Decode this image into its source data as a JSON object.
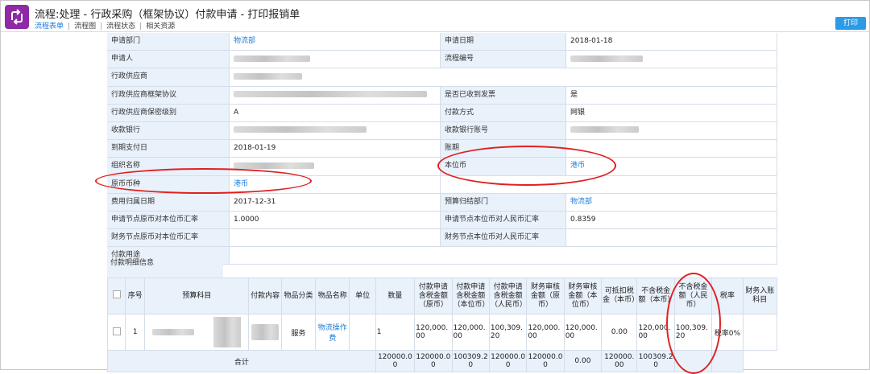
{
  "header": {
    "title": "流程:处理 - 行政采购（框架协议）付款申请 - 打印报销单",
    "tabs": [
      "流程表单",
      "流程图",
      "流程状态",
      "相关资源"
    ],
    "print_label": "打印",
    "logo_icon": "workflow-icon"
  },
  "form": {
    "rows": [
      {
        "l1": "申请部门",
        "v1": "物流部",
        "l2": "申请日期",
        "v2": "2018-01-18"
      },
      {
        "l1": "申请人",
        "v1": "",
        "l2": "流程编号",
        "v2": ""
      },
      {
        "l1": "行政供应商",
        "v1": "",
        "l2": "",
        "v2": ""
      },
      {
        "l1": "行政供应商框架协议",
        "v1": "",
        "l2": "是否已收到发票",
        "v2": "是"
      },
      {
        "l1": "行政供应商保密级别",
        "v1": "A",
        "l2": "付款方式",
        "v2": "网银"
      },
      {
        "l1": "收款银行",
        "v1": "",
        "l2": "收款银行账号",
        "v2": ""
      },
      {
        "l1": "到期支付日",
        "v1": "2018-01-19",
        "l2": "账期",
        "v2": ""
      },
      {
        "l1": "组织名称",
        "v1": "",
        "l2": "本位币",
        "v2": "港币"
      },
      {
        "l1": "原币币种",
        "v1": "港币",
        "l2": "",
        "v2": ""
      },
      {
        "l1": "费用归属日期",
        "v1": "2017-12-31",
        "l2": "预算归结部门",
        "v2": "物流部"
      },
      {
        "l1": "申请节点原币对本位币汇率",
        "v1": "1.0000",
        "l2": "申请节点本位币对人民币汇率",
        "v2": "0.8359"
      },
      {
        "l1": "财务节点原币对本位币汇率",
        "v1": "",
        "l2": "财务节点本位币对人民币汇率",
        "v2": ""
      },
      {
        "l1": "付款用途",
        "v1": "",
        "l2": "",
        "v2": ""
      }
    ]
  },
  "detail": {
    "label": "付款明细信息",
    "headers": [
      "序号",
      "预算科目",
      "付款内容",
      "物品分类",
      "物品名称",
      "单位",
      "数量",
      "付款申请含税金额（原币）",
      "付款申请含税金额（本位币）",
      "付款申请含税金额（人民币）",
      "财务审核金额（原币）",
      "财务审核金额（本位币）",
      "可抵扣税金（本币）",
      "不含税金额（本币）",
      "不含税金额（人民币）",
      "税率",
      "财务入账科目"
    ],
    "item": {
      "no": "1",
      "category": "服务",
      "name": "物流操作费",
      "qty": "1",
      "orig": "120,000.00",
      "local": "120,000.00",
      "rmb": "100,309.20",
      "fin_orig": "120,000.00",
      "fin_local": "120,000.00",
      "deduct": "0.00",
      "net_local": "120,000.00",
      "net_rmb": "100,309.20",
      "tax": "税率0%"
    },
    "total": {
      "label": "合计",
      "orig": "120000.00",
      "local": "120000.00",
      "rmb": "100309.20",
      "fin_orig": "120000.00",
      "fin_local": "120000.00",
      "deduct": "0.00",
      "net_local": "120000.00",
      "net_rmb": "100309.20"
    }
  },
  "colors": {
    "accent": "#1d7cd6",
    "label_bg": "#e9f1fb",
    "logo": "#8e2aa6",
    "annotation": "#e02020",
    "print_button": "#2d9ae6"
  }
}
